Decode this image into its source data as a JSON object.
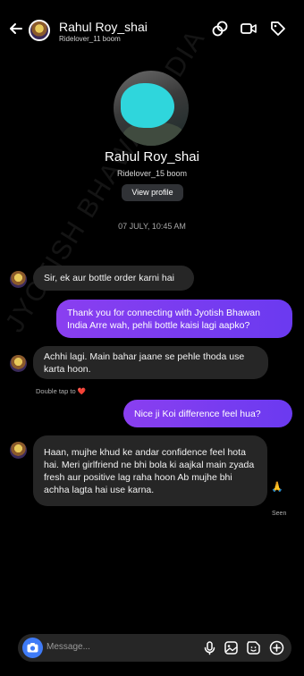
{
  "header": {
    "name": "Rahul Roy_shai",
    "subtitle": "Ridelover_11 boom",
    "icons": [
      "back-arrow-icon",
      "link-icon",
      "video-camera-icon",
      "tag-icon"
    ]
  },
  "profile": {
    "name": "Rahul Roy_shai",
    "subtitle": "Ridelover_15 boom",
    "view_profile_label": "View profile"
  },
  "date_label": "07 JULY, 10:45 AM",
  "messages": [
    {
      "from": "them",
      "text": "Sir, ek aur bottle order karni hai"
    },
    {
      "from": "me",
      "text": "Thank you for connecting with Jyotish Bhawan India  Arre wah, pehli bottle kaisi lagi aapko?"
    },
    {
      "from": "them",
      "text": "Achhi lagi. Main bahar jaane se pehle thoda use karta hoon."
    },
    {
      "from": "me",
      "text": "Nice ji  Koi difference feel hua?"
    },
    {
      "from": "them",
      "text": "Haan, mujhe khud ke andar confidence feel hota hai. Meri girlfriend ne bhi bola ki aajkal main zyada fresh aur positive lag raha hoon  Ab mujhe bhi achha lagta hai use karna."
    }
  ],
  "double_tap_hint": "Double tap to",
  "heart_emoji": "❤️",
  "pray_emoji": "🙏",
  "seen_label": "Seen",
  "watermark": "JYOTISH BHAWAN INDIA",
  "composer": {
    "placeholder": "Message..."
  },
  "colors": {
    "outgoing_bubble": "#7b3df0",
    "incoming_bubble": "#262626",
    "camera_button": "#3f7bf7"
  }
}
